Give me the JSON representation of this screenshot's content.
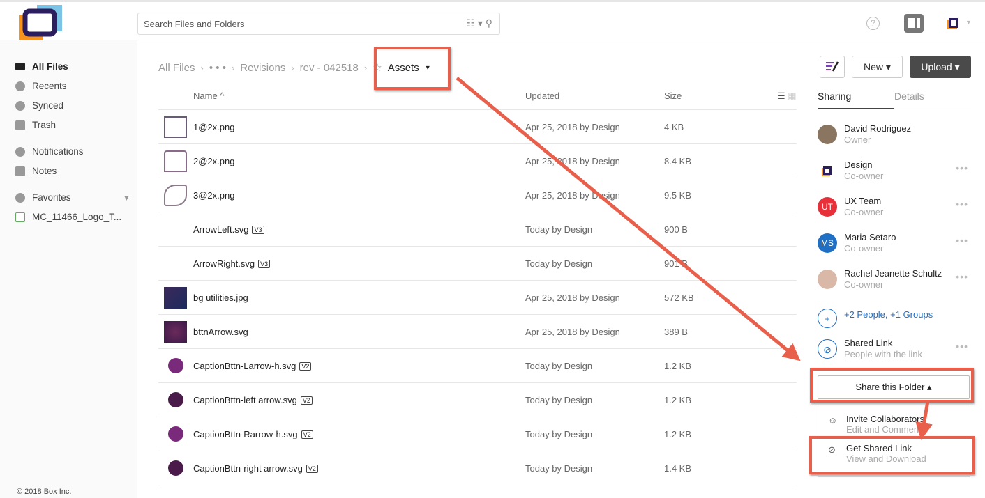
{
  "header": {
    "search_placeholder": "Search Files and Folders",
    "help": "?"
  },
  "sidebar": {
    "items": [
      {
        "label": "All Files"
      },
      {
        "label": "Recents"
      },
      {
        "label": "Synced"
      },
      {
        "label": "Trash"
      },
      {
        "label": "Notifications"
      },
      {
        "label": "Notes"
      },
      {
        "label": "Favorites"
      },
      {
        "label": "MC_11466_Logo_T..."
      }
    ],
    "copyright": "© 2018 Box Inc."
  },
  "breadcrumb": {
    "items": [
      "All Files",
      "• • •",
      "Revisions",
      "rev - 042518"
    ],
    "current": "Assets"
  },
  "columns": {
    "name": "Name ^",
    "updated": "Updated",
    "size": "Size"
  },
  "files": [
    {
      "name": "1@2x.png",
      "version": "",
      "updated": "Apr 25, 2018 by Design",
      "size": "4 KB",
      "thumb": "layout"
    },
    {
      "name": "2@2x.png",
      "version": "",
      "updated": "Apr 25, 2018 by Design",
      "size": "8.4 KB",
      "thumb": "house"
    },
    {
      "name": "3@2x.png",
      "version": "",
      "updated": "Apr 25, 2018 by Design",
      "size": "9.5 KB",
      "thumb": "phone"
    },
    {
      "name": "ArrowLeft.svg",
      "version": "V3",
      "updated": "Today by Design",
      "size": "900 B",
      "thumb": "none"
    },
    {
      "name": "ArrowRight.svg",
      "version": "V3",
      "updated": "Today by Design",
      "size": "901 B",
      "thumb": "none"
    },
    {
      "name": "bg utilities.jpg",
      "version": "",
      "updated": "Apr 25, 2018 by Design",
      "size": "572 KB",
      "thumb": "dark"
    },
    {
      "name": "bttnArrow.svg",
      "version": "",
      "updated": "Apr 25, 2018 by Design",
      "size": "389 B",
      "thumb": "purple"
    },
    {
      "name": "CaptionBttn-Larrow-h.svg",
      "version": "V2",
      "updated": "Today by Design",
      "size": "1.2 KB",
      "thumb": "circle"
    },
    {
      "name": "CaptionBttn-left arrow.svg",
      "version": "V2",
      "updated": "Today by Design",
      "size": "1.2 KB",
      "thumb": "circle-dark"
    },
    {
      "name": "CaptionBttn-Rarrow-h.svg",
      "version": "V2",
      "updated": "Today by Design",
      "size": "1.2 KB",
      "thumb": "circle"
    },
    {
      "name": "CaptionBttn-right arrow.svg",
      "version": "V2",
      "updated": "Today by Design",
      "size": "1.4 KB",
      "thumb": "circle-dark"
    }
  ],
  "toolbar": {
    "new": "New ▾",
    "upload": "Upload ▾"
  },
  "panel": {
    "tabs": [
      "Sharing",
      "Details"
    ],
    "people": [
      {
        "name": "David Rodriguez",
        "role": "Owner",
        "initials": "",
        "color": "#8a7560"
      },
      {
        "name": "Design",
        "role": "Co-owner",
        "initials": "",
        "color": "#ffffff"
      },
      {
        "name": "UX Team",
        "role": "Co-owner",
        "initials": "UT",
        "color": "#e8303a"
      },
      {
        "name": "Maria Setaro",
        "role": "Co-owner",
        "initials": "MS",
        "color": "#1f6fc5"
      },
      {
        "name": "Rachel Jeanette Schultz",
        "role": "Co-owner",
        "initials": "",
        "color": "#d9b8a8"
      }
    ],
    "more_people": "+2 People, +1 Groups",
    "shared_link": {
      "title": "Shared Link",
      "sub": "People with the link"
    },
    "share_button": "Share this Folder ▴",
    "menu": [
      {
        "title": "Invite Collaborators",
        "sub": "Edit and Comment"
      },
      {
        "title": "Get Shared Link",
        "sub": "View and Download"
      }
    ]
  },
  "colors": {
    "annotation": "#e8604c",
    "link": "#1f6fc5",
    "upload_bg": "#4a4a4a"
  }
}
